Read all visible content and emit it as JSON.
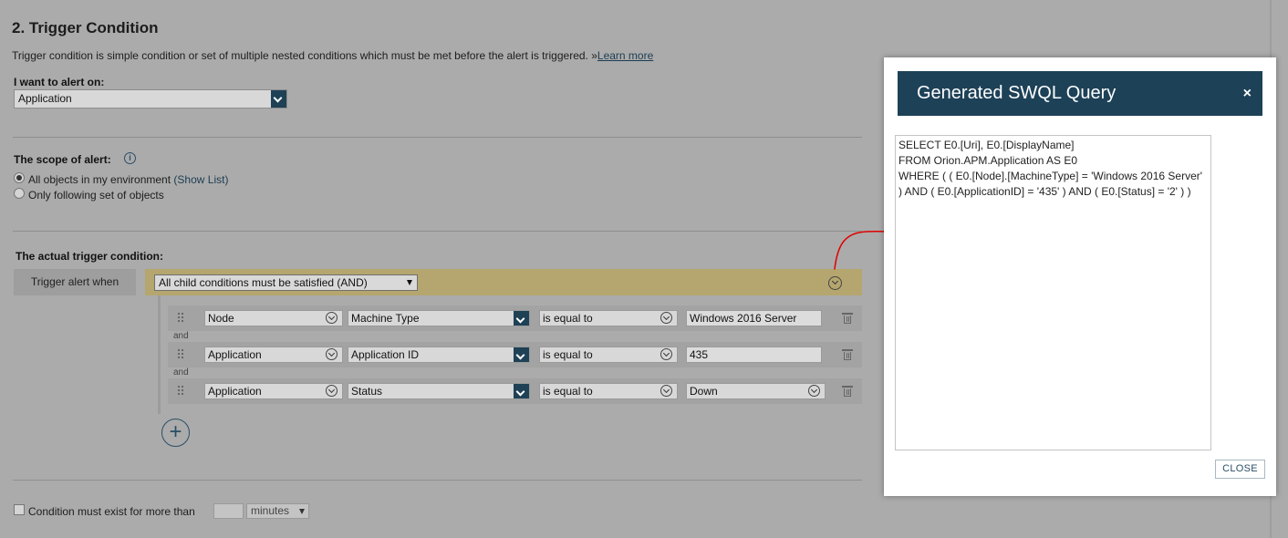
{
  "section": {
    "title": "2. Trigger Condition",
    "description": "Trigger condition is simple condition or set of multiple nested conditions which must be met before the alert is triggered. »",
    "learn_more": "Learn more"
  },
  "alert_on": {
    "label": "I want to alert on:",
    "value": "Application"
  },
  "scope": {
    "label": "The scope of alert:",
    "option_all": "All objects in my environment",
    "show_list": "(Show List)",
    "option_following": "Only following set of objects",
    "selected": "all"
  },
  "trigger": {
    "label": "The actual trigger condition:",
    "when_label": "Trigger alert when",
    "mode": "All child conditions must be satisfied (AND)",
    "and_label": "and",
    "conditions": [
      {
        "object": "Node",
        "field": "Machine Type",
        "operator": "is equal to",
        "value": "Windows 2016 Server"
      },
      {
        "object": "Application",
        "field": "Application ID",
        "operator": "is equal to",
        "value": "435"
      },
      {
        "object": "Application",
        "field": "Status",
        "operator": "is equal to",
        "value": "Down"
      }
    ]
  },
  "duration": {
    "label": "Condition must exist for more than",
    "value": "",
    "unit": "minutes"
  },
  "dialog": {
    "title": "Generated SWQL Query",
    "close_x": "×",
    "query": "SELECT E0.[Uri], E0.[DisplayName]\nFROM Orion.APM.Application AS E0\nWHERE ( ( E0.[Node].[MachineType] = 'Windows 2016 Server'\n) AND ( E0.[ApplicationID] = '435' ) AND ( E0.[Status] = '2' ) )",
    "close_button": "CLOSE"
  },
  "colors": {
    "accent": "#1d4157",
    "gold_bar": "#b5a66f",
    "annotation_arrow": "#e00000"
  }
}
